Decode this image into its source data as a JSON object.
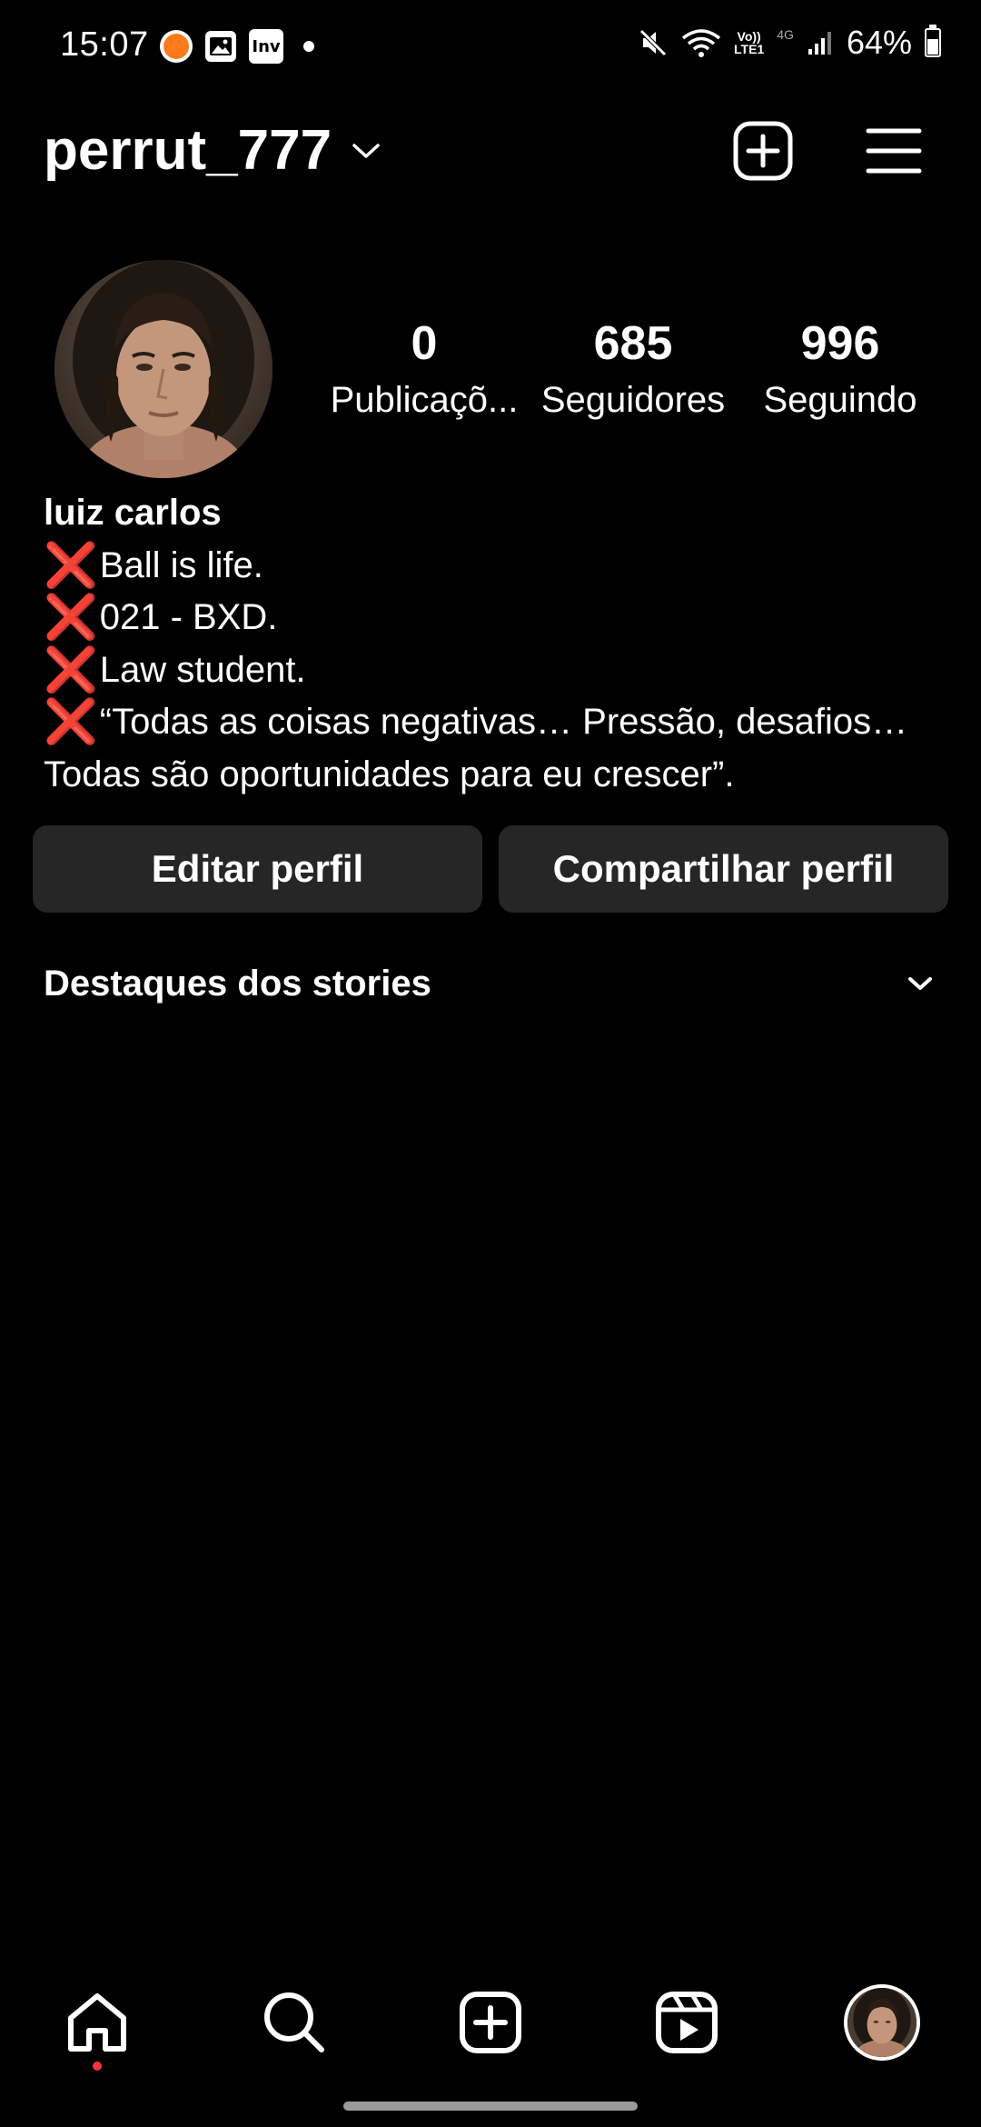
{
  "status_bar": {
    "time": "15:07",
    "lte_top": "Vo))",
    "lte_bottom": "LTE1",
    "network": "4G",
    "battery": "64%",
    "battery_level": 0.64
  },
  "header": {
    "username": "perrut_777"
  },
  "stats": [
    {
      "value": "0",
      "label": "Publicaçõ..."
    },
    {
      "value": "685",
      "label": "Seguidores"
    },
    {
      "value": "996",
      "label": "Seguindo"
    }
  ],
  "bio": {
    "name": "luiz carlos",
    "lines": [
      "Ball is life.",
      "021 - BXD.",
      "Law student.",
      "“Todas as coisas negativas… Pressão, desafios…"
    ],
    "continuation": "Todas são oportunidades para eu crescer”.",
    "bullet": "❌"
  },
  "buttons": {
    "edit": "Editar perfil",
    "share": "Compartilhar perfil"
  },
  "highlights": {
    "title": "Destaques dos stories"
  },
  "colors": {
    "background": "#000000",
    "button_bg": "#262626",
    "accent_red": "#e8232c",
    "notification_dot": "#ff3040"
  }
}
